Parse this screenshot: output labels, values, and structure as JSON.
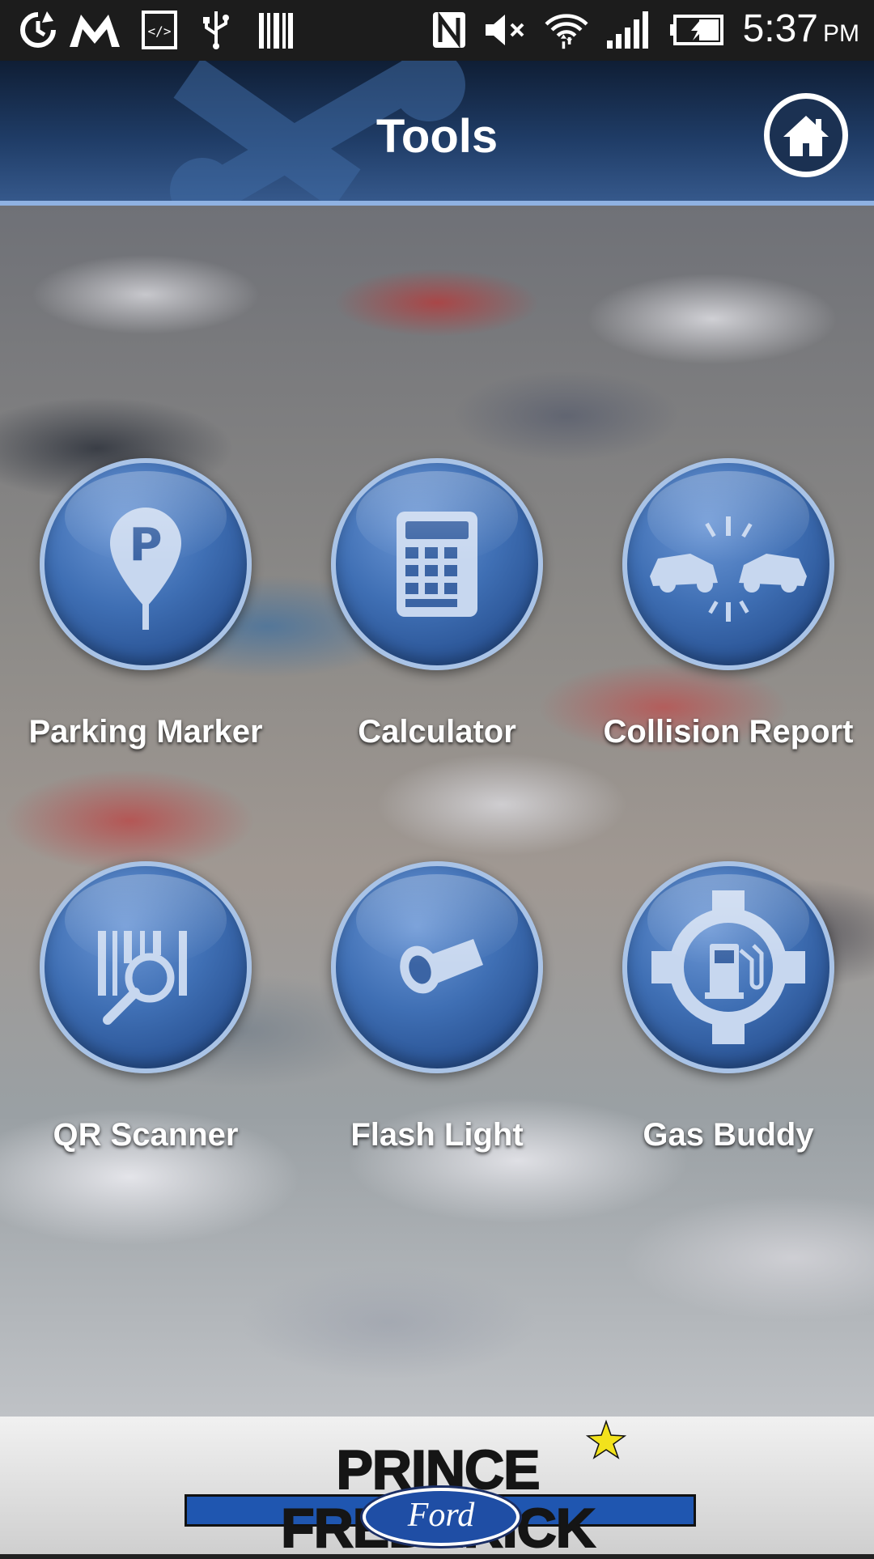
{
  "status_bar": {
    "time": "5:37",
    "ampm": "PM",
    "icons": [
      "sync-icon",
      "gmail-icon",
      "developer-icon",
      "usb-icon",
      "barcode-icon",
      "nfc-icon",
      "mute-icon",
      "wifi-icon",
      "signal-icon",
      "battery-charging-icon"
    ]
  },
  "header": {
    "title": "Tools",
    "home_icon": "home-icon",
    "accent": "#8fb2e3"
  },
  "tools": [
    {
      "label": "Parking Marker",
      "icon": "parking-marker-icon"
    },
    {
      "label": "Calculator",
      "icon": "calculator-icon"
    },
    {
      "label": "Collision Report",
      "icon": "collision-icon"
    },
    {
      "label": "QR Scanner",
      "icon": "qr-scanner-icon"
    },
    {
      "label": "Flash Light",
      "icon": "flashlight-icon"
    },
    {
      "label": "Gas Buddy",
      "icon": "gas-pump-icon"
    }
  ],
  "footer": {
    "logo_main": "PRINCE FREDERICK",
    "logo_sub": "Ford",
    "brand_color": "#1f56b0"
  }
}
